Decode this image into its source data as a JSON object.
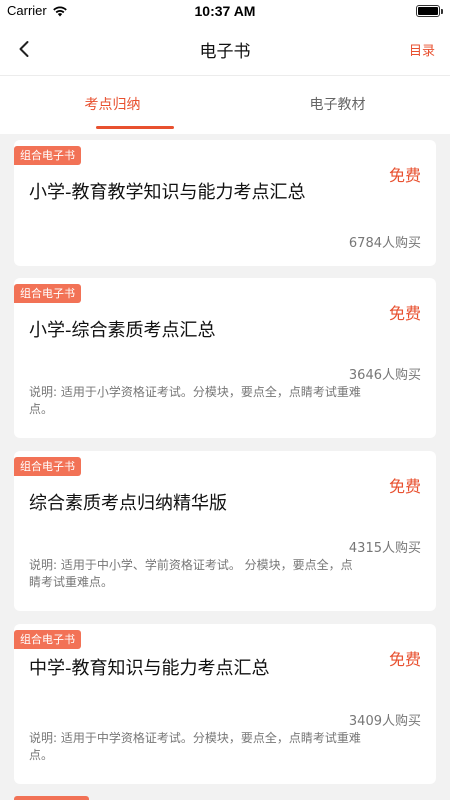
{
  "status_bar": {
    "carrier": "Carrier",
    "time": "10:37 AM"
  },
  "nav": {
    "title": "电子书",
    "toc_label": "目录",
    "back_icon": "chevron-left-icon"
  },
  "tabs": [
    {
      "label": "考点归纳",
      "active": true
    },
    {
      "label": "电子教材",
      "active": false
    }
  ],
  "books": [
    {
      "badge": "组合电子书",
      "title": "小学-教育教学知识与能力考点汇总",
      "price": "免费",
      "buyers": "6784人购买",
      "desc_line1": "",
      "desc_line2": ""
    },
    {
      "badge": "组合电子书",
      "title": "小学-综合素质考点汇总",
      "price": "免费",
      "buyers": "3646人购买",
      "desc_line1": "说明: 适用于小学资格证考试。分模块，要点全，点睛考试重难",
      "desc_line2": "点。"
    },
    {
      "badge": "组合电子书",
      "title": "综合素质考点归纳精华版",
      "price": "免费",
      "buyers": "4315人购买",
      "desc_line1": "说明: 适用于中小学、学前资格证考试。 分模块，要点全，点",
      "desc_line2": "睛考试重难点。"
    },
    {
      "badge": "组合电子书",
      "title": "中学-教育知识与能力考点汇总",
      "price": "免费",
      "buyers": "3409人购买",
      "desc_line1": "说明: 适用于中学资格证考试。分模块，要点全，点睛考试重难",
      "desc_line2": "点。"
    }
  ],
  "colors": {
    "accent": "#e8502f",
    "badge_bg": "#f27256"
  }
}
